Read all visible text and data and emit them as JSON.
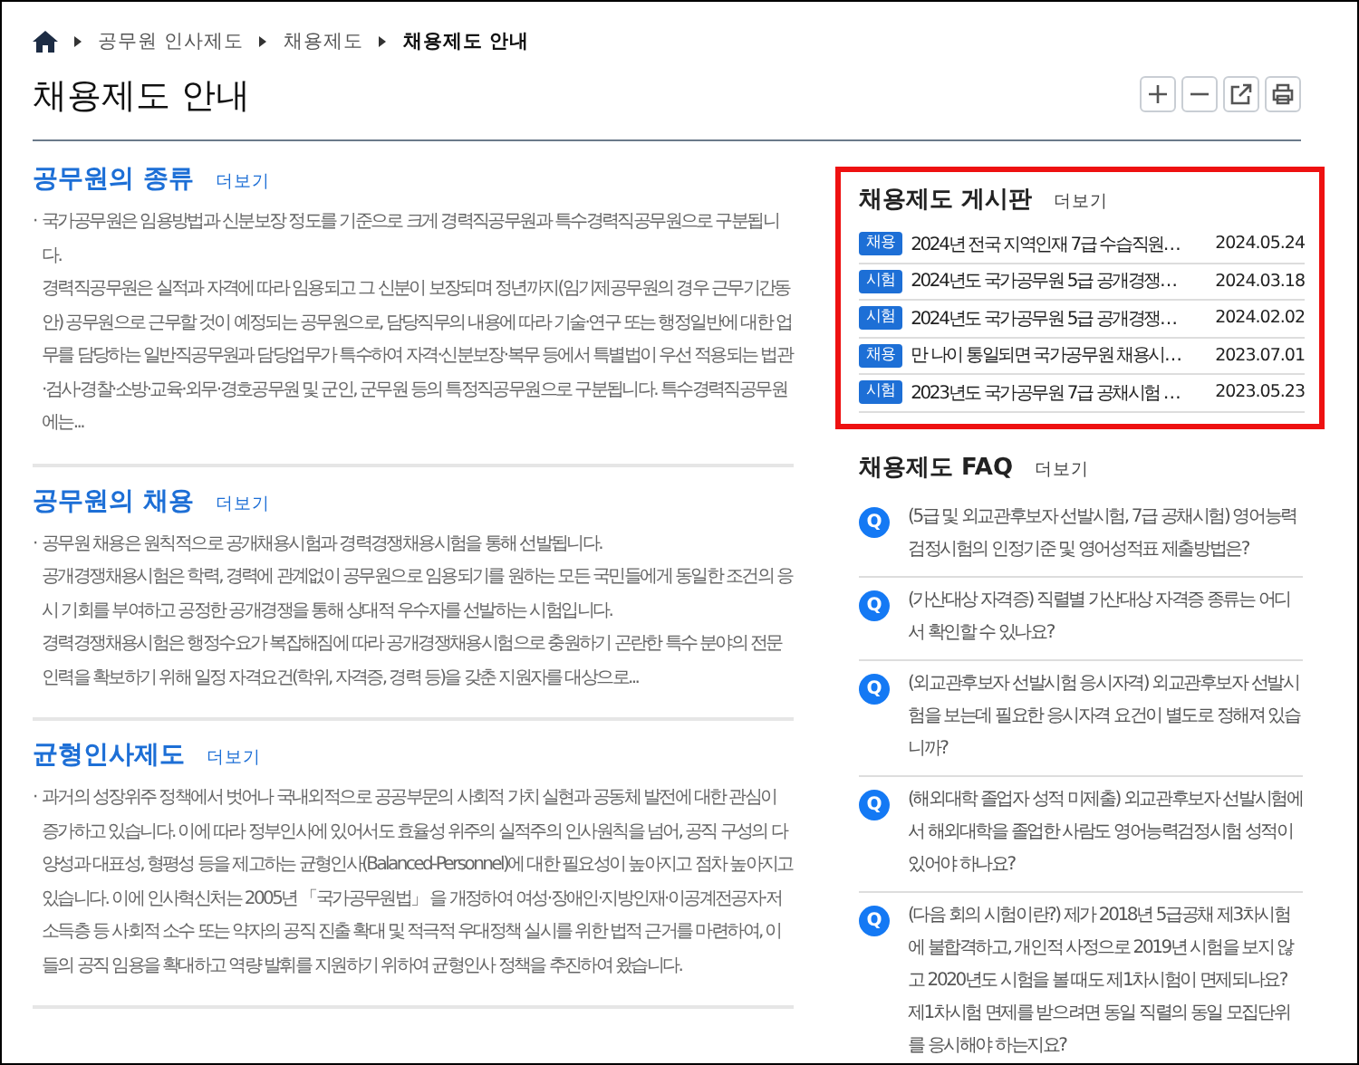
{
  "breadcrumb": {
    "items": [
      "공무원 인사제도",
      "채용제도"
    ],
    "current": "채용제도 안내"
  },
  "page_title": "채용제도 안내",
  "sections": [
    {
      "title": "공무원의 종류",
      "more": "더보기",
      "bullet": "·",
      "paragraphs": [
        "국가공무원은 임용방법과 신분보장 정도를 기준으로 크게 경력직공무원과 특수경력직공무원으로 구분됩니다.",
        "경력직공무원은 실적과 자격에 따라 임용되고 그 신분이 보장되며 정년까지(임기제공무원의 경우 근무기간동안) 공무원으로 근무할 것이 예정되는 공무원으로, 담당직무의 내용에 따라 기술·연구 또는 행정일반에 대한 업무를 담당하는 일반직공무원과 담당업무가 특수하여 자격·신분보장·복무 등에서 특별법이 우선 적용되는 법관·검사·경찰·소방·교육·외무·경호공무원 및 군인, 군무원 등의 특정직공무원으로 구분됩니다. 특수경력직공무원에는..."
      ]
    },
    {
      "title": "공무원의 채용",
      "more": "더보기",
      "bullet": "·",
      "paragraphs": [
        "공무원 채용은 원칙적으로 공개채용시험과 경력경쟁채용시험을 통해 선발됩니다.",
        "공개경쟁채용시험은 학력, 경력에 관계없이 공무원으로 임용되기를 원하는 모든 국민들에게 동일한 조건의 응시 기회를 부여하고 공정한 공개경쟁을 통해 상대적 우수자를 선발하는 시험입니다.",
        "경력경쟁채용시험은 행정수요가 복잡해짐에 따라 공개경쟁채용시험으로 충원하기 곤란한 특수 분야의 전문인력을 확보하기 위해 일정 자격요건(학위, 자격증, 경력 등)을 갖춘 지원자를 대상으로..."
      ]
    },
    {
      "title": "균형인사제도",
      "more": "더보기",
      "bullet": "·",
      "paragraphs": [
        "과거의 성장위주 정책에서 벗어나 국내외적으로 공공부문의 사회적 가치 실현과 공동체 발전에 대한 관심이 증가하고 있습니다. 이에 따라 정부인사에 있어서도 효율성 위주의 실적주의 인사원칙을 넘어, 공직 구성의 다양성과 대표성, 형평성 등을 제고하는 균형인사(Balanced-Personnel)에 대한 필요성이 높아지고 점차 높아지고 있습니다. 이에 인사혁신처는 2005년 「국가공무원법」 을 개정하여 여성·장애인·지방인재·이공계전공자·저소득층 등 사회적 소수 또는 약자의 공직 진출 확대 및 적극적 우대정책 실시를 위한 법적 근거를 마련하여, 이들의 공직 임용을 확대하고 역량 발휘를 지원하기 위하여 균형인사 정책을 추진하여 왔습니다."
      ]
    }
  ],
  "board": {
    "title": "채용제도 게시판",
    "more": "더보기",
    "highlighted": true,
    "rows": [
      {
        "tag": "채용",
        "title": "2024년 전국 지역인재 7급 수습직원…",
        "date": "2024.05.24"
      },
      {
        "tag": "시험",
        "title": "2024년도 국가공무원 5급 공개경쟁…",
        "date": "2024.03.18"
      },
      {
        "tag": "시험",
        "title": "2024년도 국가공무원 5급 공개경쟁…",
        "date": "2024.02.02"
      },
      {
        "tag": "채용",
        "title": "만 나이 통일되면 국가공무원 채용시…",
        "date": "2023.07.01"
      },
      {
        "tag": "시험",
        "title": "2023년도 국가공무원 7급 공채시험 …",
        "date": "2023.05.23"
      }
    ]
  },
  "faq": {
    "title": "채용제도 FAQ",
    "more": "더보기",
    "items": [
      {
        "mark": "Q",
        "question": "(5급 및 외교관후보자 선발시험, 7급 공채시험) 영어능력검정시험의 인정기준 및 영어성적표 제출방법은?"
      },
      {
        "mark": "Q",
        "question": "(가산대상 자격증) 직렬별 가산대상 자격증 종류는 어디서 확인할 수 있나요?"
      },
      {
        "mark": "Q",
        "question": "(외교관후보자 선발시험 응시자격) 외교관후보자 선발시험을 보는데 필요한 응시자격 요건이 별도로 정해져 있습니까?"
      },
      {
        "mark": "Q",
        "question": "(해외대학 졸업자 성적 미제출) 외교관후보자 선발시험에서 해외대학을 졸업한 사람도 영어능력검정시험 성적이 있어야 하나요?"
      },
      {
        "mark": "Q",
        "question": "(다음 회의 시험이란?) 제가 2018년 5급공채 제3차시험에 불합격하고, 개인적 사정으로 2019년 시험을 보지 않고 2020년도 시험을 볼 때도 제1차시험이 면제되나요? 제1차시험 면제를 받으려면 동일 직렬의 동일 모집단위를 응시해야 하는지요?"
      }
    ]
  }
}
